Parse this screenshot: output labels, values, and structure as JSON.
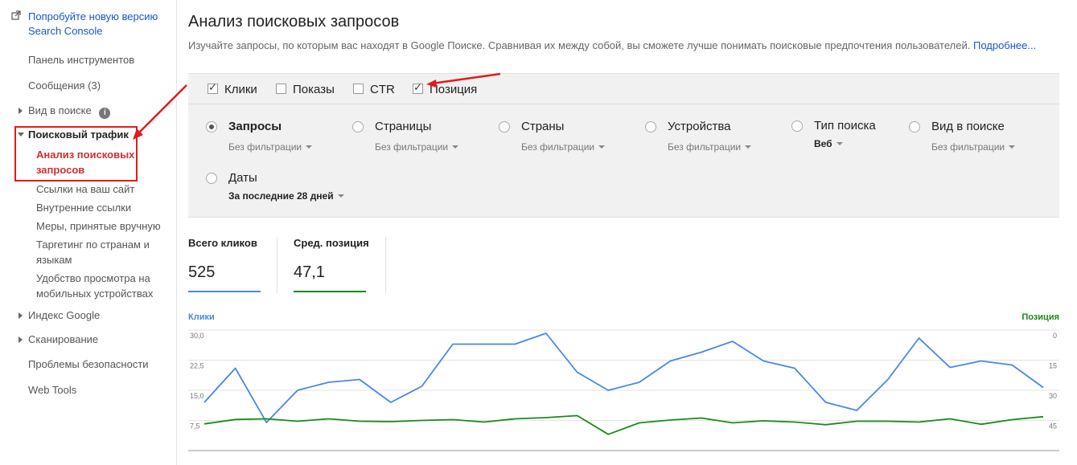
{
  "sidebar": {
    "promo": "Попробуйте новую версию Search Console",
    "items": {
      "dashboard": "Панель инструментов",
      "messages": "Сообщения (3)",
      "search_appearance": "Вид в поиске",
      "search_traffic": "Поисковый трафик",
      "google_index": "Индекс Google",
      "crawl": "Сканирование",
      "security": "Проблемы безопасности",
      "web_tools": "Web Tools"
    },
    "info_glyph": "i",
    "sub_items": [
      "Анализ поисковых запросов",
      "Ссылки на ваш сайт",
      "Внутренние ссылки",
      "Меры, принятые вручную",
      "Таргетинг по странам и языкам",
      "Удобство просмотра на мобильных устройствах"
    ]
  },
  "main": {
    "title": "Анализ поисковых запросов",
    "description": "Изучайте запросы, по которым вас находят в Google Поиске. Сравнивая их между собой, вы сможете лучше понимать поисковые предпочтения пользователей.",
    "more_link": "Подробнее..."
  },
  "metrics": [
    {
      "label": "Клики",
      "checked": true
    },
    {
      "label": "Показы",
      "checked": false
    },
    {
      "label": "CTR",
      "checked": false
    },
    {
      "label": "Позиция",
      "checked": true
    }
  ],
  "groups": [
    {
      "label": "Запросы",
      "filter": "Без фильтрации",
      "selected": true
    },
    {
      "label": "Страницы",
      "filter": "Без фильтрации",
      "selected": false
    },
    {
      "label": "Страны",
      "filter": "Без фильтрации",
      "selected": false
    },
    {
      "label": "Устройства",
      "filter": "Без фильтрации",
      "selected": false
    },
    {
      "label": "Тип поиска",
      "filter": "Веб",
      "selected": false
    },
    {
      "label": "Вид в поиске",
      "filter": "Без фильтрации",
      "selected": false
    },
    {
      "label": "Даты",
      "filter": "За последние 28 дней",
      "selected": false
    }
  ],
  "stats": {
    "clicks": {
      "label": "Всего кликов",
      "value": "525",
      "color": "#4a86e8"
    },
    "position": {
      "label": "Сред. позиция",
      "value": "47,1",
      "color": "#1b8a1b"
    }
  },
  "colors": {
    "link": "#1a55c8",
    "highlight": "#e21b1b",
    "active_nav": "#d32f2f",
    "clicks_line": "#4a86e8",
    "position_line": "#1b8a1b"
  },
  "chart_data": {
    "type": "line",
    "legend_left": "Клики",
    "legend_right": "Позиция",
    "y_left_ticks": [
      "30,0",
      "22,5",
      "15,0",
      "7,5"
    ],
    "y_right_ticks": [
      "0",
      "15",
      "30",
      "45"
    ],
    "ylim_left": [
      0,
      30
    ],
    "ylim_right": [
      60,
      0
    ],
    "grid": true,
    "series": [
      {
        "name": "Клики",
        "axis": "left",
        "values": [
          12,
          20.5,
          7,
          15,
          17,
          17.7,
          12,
          16,
          26.5,
          26.5,
          26.5,
          29.2,
          19.5,
          15,
          17,
          22.3,
          24.5,
          27.2,
          22.3,
          20.5,
          12,
          10,
          17.7,
          28,
          20.7,
          22.3,
          21.3,
          15.7
        ]
      },
      {
        "name": "Позиция",
        "axis": "right",
        "values": [
          46.7,
          44.5,
          44.2,
          45.4,
          44.2,
          45.4,
          45.6,
          45,
          44.6,
          45.8,
          44.2,
          43.6,
          42.6,
          51.9,
          46.2,
          44.8,
          43.8,
          46.2,
          45.2,
          45.8,
          47.1,
          45.4,
          45.4,
          45.8,
          44.2,
          46.9,
          44.6,
          43.1
        ]
      }
    ]
  }
}
